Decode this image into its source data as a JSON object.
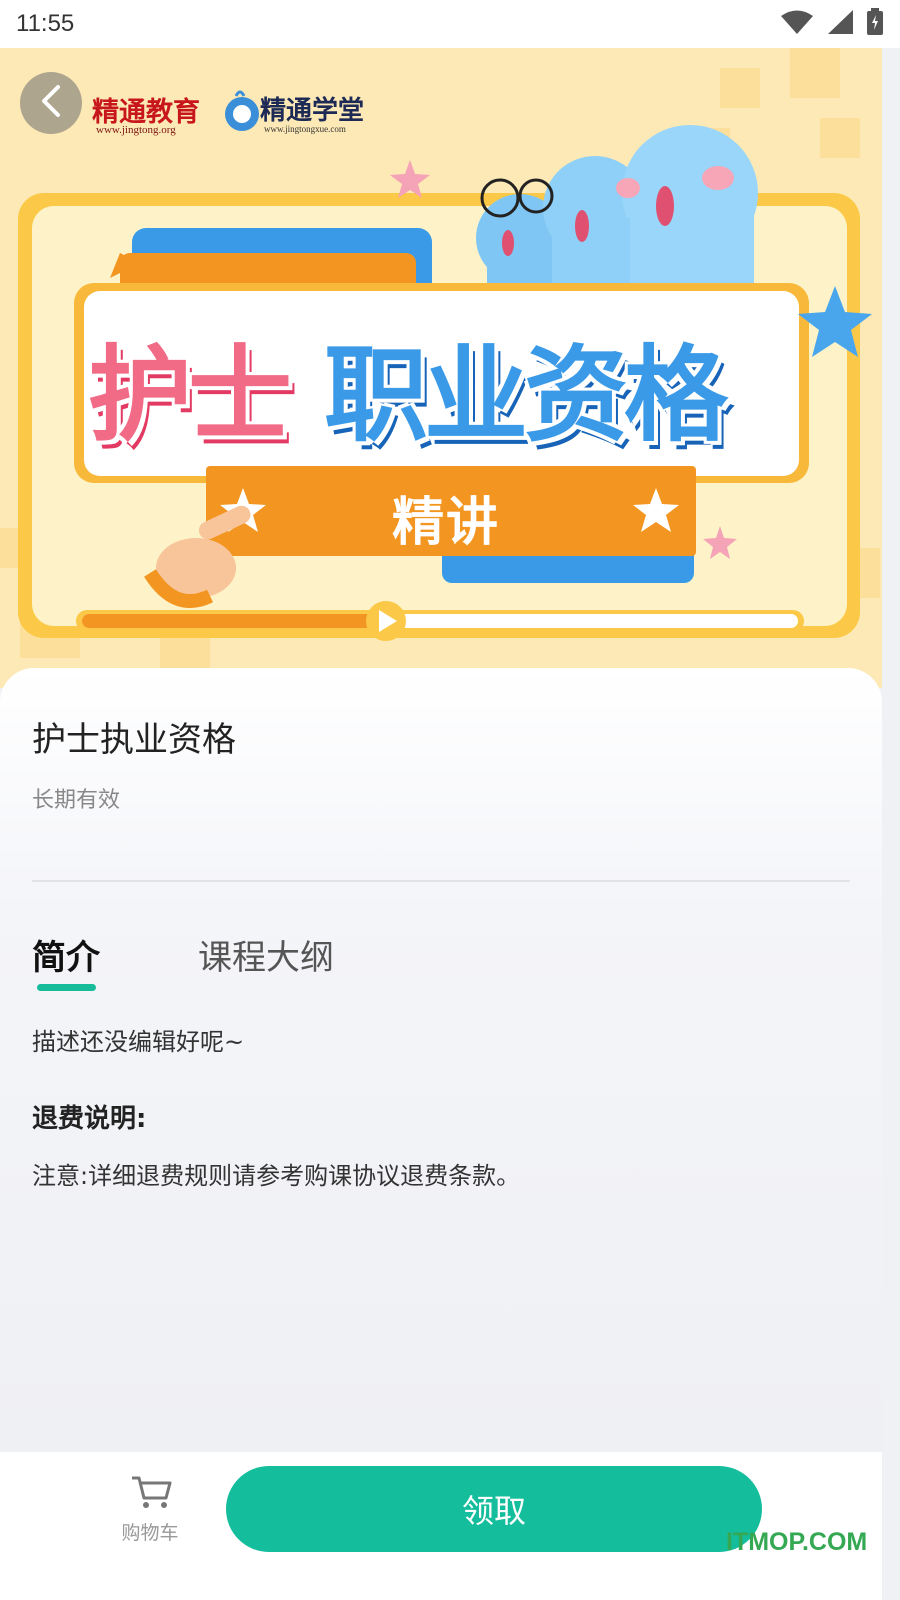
{
  "status_bar": {
    "time": "11:55"
  },
  "banner": {
    "logo1_text": "精通教育",
    "logo1_url": "www.jingtong.org",
    "logo2_text": "精通学堂",
    "logo2_url": "www.jingtongxue.com",
    "title_pink": "护士",
    "title_blue": "职业资格",
    "subtitle": "精讲"
  },
  "course": {
    "title": "护士执业资格",
    "validity": "长期有效"
  },
  "tabs": [
    {
      "label": "简介",
      "active": true
    },
    {
      "label": "课程大纲",
      "active": false
    }
  ],
  "intro": {
    "description": "描述还没编辑好呢~",
    "refund_title": "退费说明:",
    "refund_note": "注意:详细退费规则请参考购课协议退费条款。"
  },
  "bottom_bar": {
    "cart_label": "购物车",
    "claim_label": "领取"
  },
  "watermark": "ITMOP.COM",
  "colors": {
    "accent": "#14bd9c",
    "banner_bg": "#fde9b5",
    "banner_orange": "#f39521",
    "banner_blue": "#3a9ae8",
    "banner_pink": "#f16a86"
  }
}
